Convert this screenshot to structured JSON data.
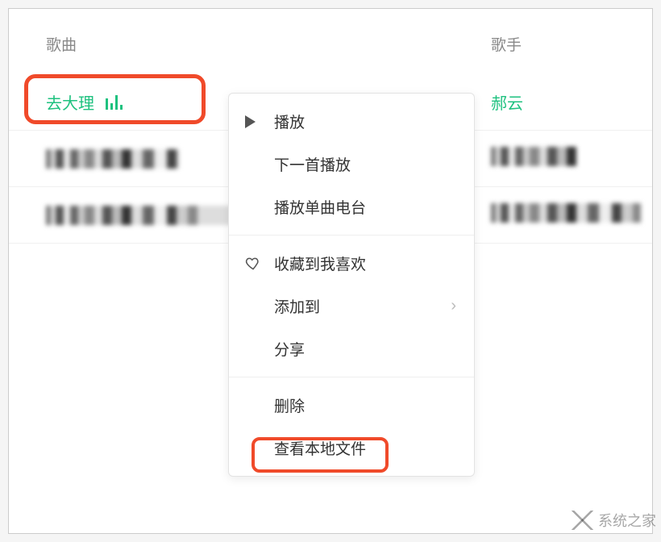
{
  "columns": {
    "song": "歌曲",
    "artist": "歌手"
  },
  "playing": {
    "title": "去大理",
    "artist": "郝云"
  },
  "play_icon": "equalizer-icon",
  "menu": {
    "play": "播放",
    "play_next": "下一首播放",
    "play_radio": "播放单曲电台",
    "fav": "收藏到我喜欢",
    "add_to": "添加到",
    "share": "分享",
    "delete": "删除",
    "view_local": "查看本地文件"
  },
  "watermark": "系统之家"
}
